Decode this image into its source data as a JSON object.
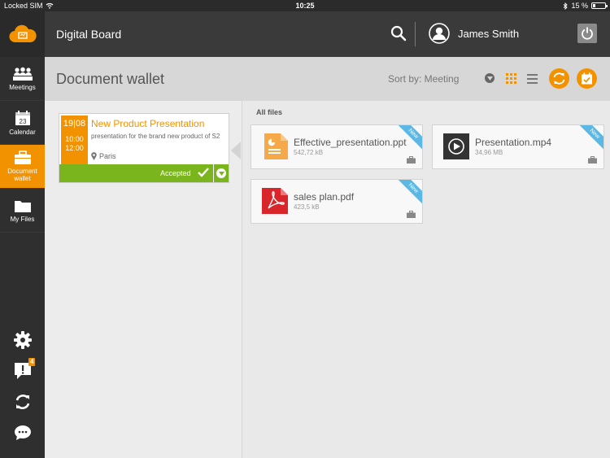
{
  "status_bar": {
    "carrier": "Locked SIM",
    "time": "10:25",
    "battery": "15 %"
  },
  "sidebar": {
    "items": [
      {
        "label": "Meetings",
        "icon": "meetings-icon"
      },
      {
        "label": "Calendar",
        "icon": "calendar-icon",
        "day": "23"
      },
      {
        "label": "Document wallet",
        "icon": "briefcase-icon",
        "active": true
      },
      {
        "label": "My Files",
        "icon": "folder-icon"
      }
    ],
    "notifications_count": "4"
  },
  "header": {
    "app_title": "Digital Board",
    "user_name": "James Smith"
  },
  "toolbar": {
    "page_title": "Document wallet",
    "sort_label": "Sort by: Meeting"
  },
  "meeting": {
    "date": "19|08",
    "start_time": "10:00",
    "end_time": "12:00",
    "title": "New Product Presentation",
    "description": "presentation for the brand new product of S2",
    "location": "Paris",
    "status": "Accepted"
  },
  "files": {
    "heading": "All files",
    "items": [
      {
        "name": "Effective_presentation.ppt",
        "size": "542,72 kB",
        "badge": "New",
        "type": "ppt"
      },
      {
        "name": "Presentation.mp4",
        "size": "34,96 MB",
        "badge": "New",
        "type": "video"
      },
      {
        "name": "sales plan.pdf",
        "size": "423,5 kB",
        "badge": "New",
        "type": "pdf"
      }
    ]
  },
  "colors": {
    "accent": "#f39200",
    "accepted": "#7ab51d",
    "new_ribbon": "#5bb7e3",
    "sidebar": "#2f2f2f",
    "header": "#3a3a3a"
  }
}
